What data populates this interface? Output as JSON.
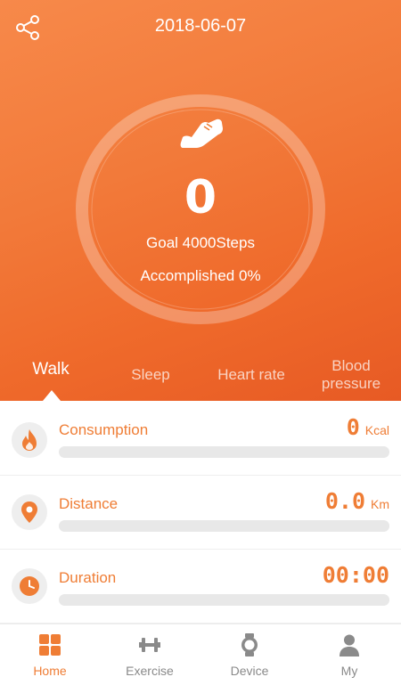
{
  "header": {
    "date": "2018-06-07"
  },
  "summary": {
    "steps": "0",
    "goal": "Goal 4000Steps",
    "accomplished": "Accomplished 0%",
    "progress": 0
  },
  "tabs": [
    {
      "label": "Walk",
      "active": true
    },
    {
      "label": "Sleep"
    },
    {
      "label": "Heart rate"
    },
    {
      "label": "Blood",
      "label2": "pressure"
    }
  ],
  "metrics": [
    {
      "label": "Consumption",
      "value": "0",
      "unit": "Kcal",
      "icon": "flame-icon",
      "progress": 0
    },
    {
      "label": "Distance",
      "value": "0.0",
      "unit": "Km",
      "icon": "location-pin-icon",
      "progress": 0
    },
    {
      "label": "Duration",
      "value": "00:00",
      "unit": "",
      "icon": "clock-icon",
      "progress": 0
    }
  ],
  "nav": [
    {
      "label": "Home",
      "icon": "home-grid-icon",
      "active": true
    },
    {
      "label": "Exercise",
      "icon": "dumbbell-icon"
    },
    {
      "label": "Device",
      "icon": "watch-icon"
    },
    {
      "label": "My",
      "icon": "person-icon"
    }
  ],
  "colors": {
    "accent": "#ef7d35",
    "hero_start": "#f7894a",
    "hero_end": "#e75a24"
  }
}
